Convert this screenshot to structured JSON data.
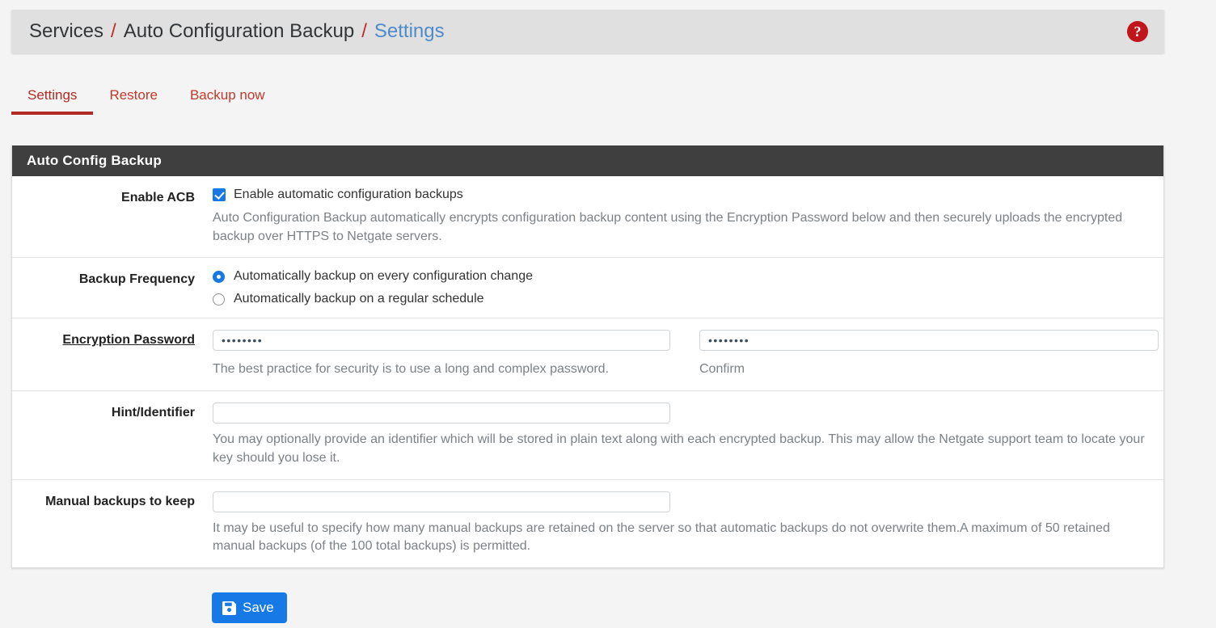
{
  "breadcrumb": {
    "items": [
      "Services",
      "Auto Configuration Backup",
      "Settings"
    ],
    "separator": "/",
    "help_icon": "?",
    "active_color": "#4f8bc9",
    "separator_color": "#bf2b2b"
  },
  "tabs": [
    {
      "label": "Settings",
      "active": true
    },
    {
      "label": "Restore",
      "active": false
    },
    {
      "label": "Backup now",
      "active": false
    }
  ],
  "panel": {
    "heading": "Auto Config Backup",
    "rows": {
      "enable_acb": {
        "label": "Enable ACB",
        "checkbox_label": "Enable automatic configuration backups",
        "checked": true,
        "help": "Auto Configuration Backup automatically encrypts configuration backup content using the Encryption Password below and then securely uploads the encrypted backup over HTTPS to Netgate servers."
      },
      "backup_frequency": {
        "label": "Backup Frequency",
        "options": [
          {
            "label": "Automatically backup on every configuration change",
            "selected": true
          },
          {
            "label": "Automatically backup on a regular schedule",
            "selected": false
          }
        ]
      },
      "encryption_password": {
        "label": "Encryption Password",
        "required": true,
        "password_value": "••••••••",
        "password_placeholder": "",
        "password_help": "The best practice for security is to use a long and complex password.",
        "confirm_value": "••••••••",
        "confirm_placeholder": "",
        "confirm_help": "Confirm"
      },
      "hint_identifier": {
        "label": "Hint/Identifier",
        "value": "",
        "placeholder": "",
        "help": "You may optionally provide an identifier which will be stored in plain text along with each encrypted backup. This may allow the Netgate support team to locate your key should you lose it."
      },
      "manual_backups": {
        "label": "Manual backups to keep",
        "value": "",
        "placeholder": "",
        "help": "It may be useful to specify how many manual backups are retained on the server so that automatic backups do not overwrite them.A maximum of 50 retained manual backups (of the 100 total backups) is permitted."
      }
    }
  },
  "actions": {
    "save_label": "Save",
    "save_icon": "save-floppy-icon",
    "save_color": "#1779e6"
  }
}
